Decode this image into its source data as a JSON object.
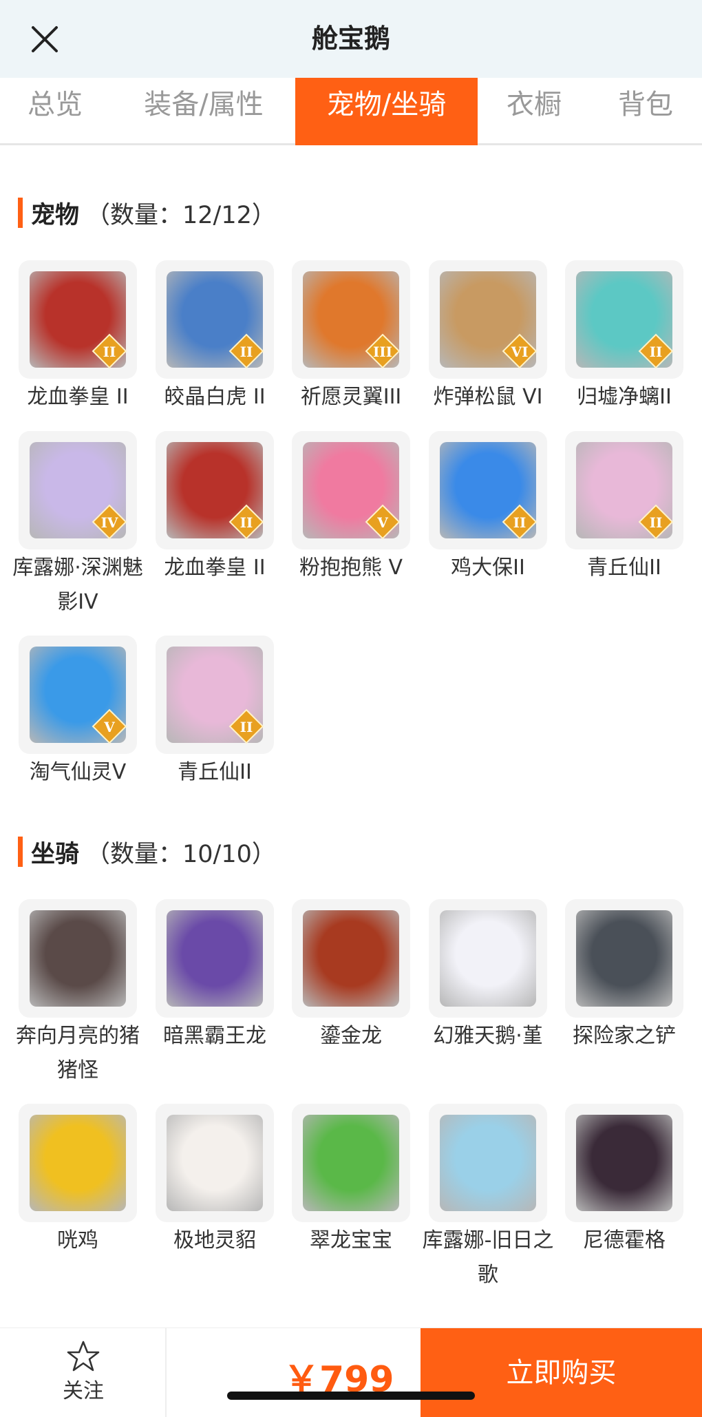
{
  "header": {
    "title": "舱宝鹅"
  },
  "tabs": [
    {
      "label": "总览"
    },
    {
      "label": "装备/属性"
    },
    {
      "label": "宠物/坐骑"
    },
    {
      "label": "衣橱"
    },
    {
      "label": "背包"
    }
  ],
  "active_tab": "宠物/坐骑",
  "pets": {
    "title": "宠物",
    "count": "（数量：12/12）",
    "items": [
      {
        "name": "龙血拳皇 II",
        "tier": "II",
        "icon": "red-dragon-ram",
        "color": "#b8322a"
      },
      {
        "name": "皎晶白虎 II",
        "tier": "II",
        "icon": "white-tiger",
        "color": "#4a7fc8"
      },
      {
        "name": "祈愿灵翼III",
        "tier": "III",
        "icon": "phoenix-bird",
        "color": "#e0782c"
      },
      {
        "name": "炸弹松鼠 VI",
        "tier": "VI",
        "icon": "squirrel",
        "color": "#c89a62"
      },
      {
        "name": "归墟净螭II",
        "tier": "II",
        "icon": "cyan-dragon",
        "color": "#5cc8c4"
      },
      {
        "name": "库露娜·深渊魅影IV",
        "tier": "IV",
        "icon": "ghost-girl",
        "color": "#c9b8e8"
      },
      {
        "name": "龙血拳皇 II",
        "tier": "II",
        "icon": "red-dragon-ram",
        "color": "#b8322a"
      },
      {
        "name": "粉抱抱熊 V",
        "tier": "V",
        "icon": "pink-bear",
        "color": "#f07aa0"
      },
      {
        "name": "鸡大保II",
        "tier": "II",
        "icon": "blue-chicken",
        "color": "#3a8ae8"
      },
      {
        "name": "青丘仙II",
        "tier": "II",
        "icon": "fox-fairy",
        "color": "#e8b8d8"
      },
      {
        "name": "淘气仙灵V",
        "tier": "V",
        "icon": "blue-puppy",
        "color": "#3a9ae8"
      },
      {
        "name": "青丘仙II",
        "tier": "II",
        "icon": "fox-fairy",
        "color": "#e8b8d8"
      }
    ]
  },
  "mounts": {
    "title": "坐骑",
    "count": "（数量：10/10）",
    "items": [
      {
        "name": "奔向月亮的猪猪怪",
        "icon": "moon-pig",
        "color": "#5a4a48"
      },
      {
        "name": "暗黑霸王龙",
        "icon": "dark-trex",
        "color": "#6a4aa8"
      },
      {
        "name": "鎏金龙",
        "icon": "gold-dragon",
        "color": "#a83a20"
      },
      {
        "name": "幻雅天鹅·堇",
        "icon": "swan",
        "color": "#f2f2f8"
      },
      {
        "name": "探险家之铲",
        "icon": "shovel",
        "color": "#4a5058"
      },
      {
        "name": "咣鸡",
        "icon": "yellow-chick",
        "color": "#f0c020"
      },
      {
        "name": "极地灵貂",
        "icon": "polar-mink",
        "color": "#f4f0ec"
      },
      {
        "name": "翠龙宝宝",
        "icon": "green-dragon",
        "color": "#5ab848"
      },
      {
        "name": "库露娜-旧日之歌",
        "icon": "cloud-girl",
        "color": "#9ad0e8"
      },
      {
        "name": "尼德霍格",
        "icon": "black-dragon",
        "color": "#3a2a38"
      }
    ]
  },
  "bottom": {
    "follow_label": "关注",
    "price": "￥799",
    "buy_label": "立即购买"
  },
  "colors": {
    "accent": "#ff6014",
    "price": "#ff5b10",
    "header_bg": "#eef5f8"
  }
}
